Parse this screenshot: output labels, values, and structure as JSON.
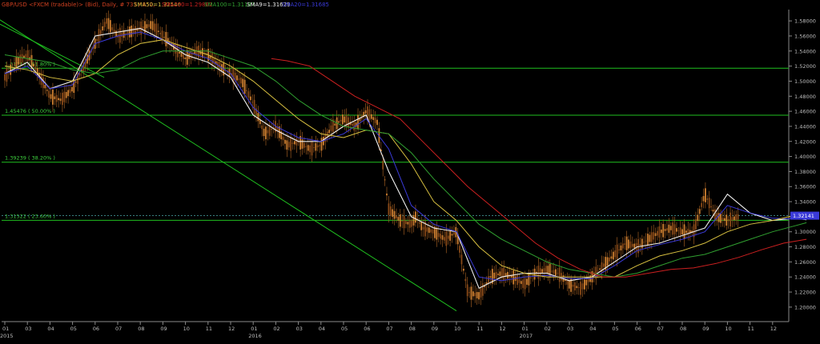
{
  "header": {
    "symbol": "GBP/USD <FXCM (tradable)> (Bid), Daily, # 733 / 852,",
    "sma50": "SMA50=1.32546",
    "sma200": "SMA200=1.29862",
    "sma100": "SMA100=1.31187",
    "sma9": "SMA9=1.31629",
    "sma20": "SMA20=1.31685",
    "colors": {
      "symbol": "#d04020",
      "sma50": "#d8c040",
      "sma200": "#cc2020",
      "sma100": "#30a030",
      "sma9": "#e8e8e8",
      "sma20": "#3a3ad8"
    }
  },
  "price_tag": {
    "value": "1.32141",
    "bg": "#3a3ad8"
  },
  "fib_levels": [
    {
      "label": "1.51713 ( 61.80% )",
      "value": 1.51713
    },
    {
      "label": "1.45476 ( 50.00% )",
      "value": 1.45476
    },
    {
      "label": "1.39239 ( 38.20% )",
      "value": 1.39239
    },
    {
      "label": "1.31522 ( 23.60% )",
      "value": 1.31522
    }
  ],
  "chart_data": {
    "type": "candlestick",
    "title": "",
    "xlabel": "",
    "ylabel": "",
    "ylim": [
      1.185,
      1.595
    ],
    "grid": false,
    "y_ticks": [
      "1.58000",
      "1.56000",
      "1.54000",
      "1.52000",
      "1.50000",
      "1.48000",
      "1.46000",
      "1.44000",
      "1.42000",
      "1.40000",
      "1.38000",
      "1.36000",
      "1.34000",
      "1.32000",
      "1.30000",
      "1.28000",
      "1.26000",
      "1.24000",
      "1.22000",
      "1.20000"
    ],
    "x_ticks": [
      "01",
      "03",
      "04",
      "05",
      "06",
      "07",
      "08",
      "09",
      "10",
      "11",
      "12",
      "01",
      "02",
      "03",
      "04",
      "05",
      "06",
      "07",
      "08",
      "09",
      "10",
      "11",
      "12",
      "01",
      "02",
      "03",
      "04",
      "05",
      "06",
      "07",
      "08",
      "09",
      "10",
      "11",
      "12"
    ],
    "x_years": [
      {
        "label": "2015",
        "at_tick": 0
      },
      {
        "label": "2016",
        "at_tick": 11
      },
      {
        "label": "2017",
        "at_tick": 23
      }
    ],
    "series": [
      {
        "name": "GBP/USD",
        "months": [
          0,
          0.5,
          1,
          1.5,
          2,
          2.5,
          3,
          3.5,
          4,
          4.5,
          5,
          5.5,
          6,
          6.5,
          7,
          7.5,
          8,
          8.5,
          9,
          9.5,
          10,
          10.5,
          11,
          11.5,
          12,
          12.5,
          13,
          13.5,
          14,
          14.5,
          15,
          15.5,
          16,
          16.5,
          17,
          17.5,
          18,
          18.2,
          18.5,
          19,
          19.5,
          20,
          20.5,
          21,
          21.5,
          22,
          22.5,
          23,
          23.5,
          24,
          24.5,
          25,
          25.5,
          26,
          26.5,
          27,
          27.5,
          28,
          28.5,
          29,
          29.5,
          30,
          30.5,
          31,
          31.5,
          32,
          32.5,
          33,
          33.5,
          34,
          34.5,
          35,
          35.5
        ],
        "values": [
          1.505,
          1.525,
          1.535,
          1.51,
          1.48,
          1.475,
          1.49,
          1.52,
          1.55,
          1.58,
          1.56,
          1.565,
          1.57,
          1.575,
          1.56,
          1.545,
          1.53,
          1.54,
          1.535,
          1.52,
          1.51,
          1.5,
          1.47,
          1.43,
          1.44,
          1.415,
          1.42,
          1.41,
          1.415,
          1.44,
          1.45,
          1.44,
          1.46,
          1.445,
          1.33,
          1.315,
          1.31,
          1.32,
          1.305,
          1.3,
          1.29,
          1.3,
          1.22,
          1.215,
          1.24,
          1.245,
          1.24,
          1.23,
          1.245,
          1.25,
          1.245,
          1.23,
          1.225,
          1.24,
          1.255,
          1.27,
          1.285,
          1.28,
          1.29,
          1.3,
          1.305,
          1.3,
          1.3,
          1.35,
          1.32,
          1.315,
          1.32
        ]
      },
      {
        "name": "SMA9",
        "months": [
          0,
          1,
          2,
          3,
          4,
          5,
          6,
          7,
          8,
          9,
          10,
          11,
          12,
          13,
          14,
          15,
          16,
          17,
          18,
          19,
          20,
          21,
          22,
          23,
          24,
          25,
          26,
          27,
          28,
          29,
          30,
          31,
          32,
          33,
          34,
          35,
          35.5
        ],
        "values": [
          1.51,
          1.525,
          1.49,
          1.5,
          1.56,
          1.565,
          1.57,
          1.555,
          1.535,
          1.525,
          1.505,
          1.455,
          1.435,
          1.42,
          1.42,
          1.44,
          1.455,
          1.38,
          1.32,
          1.305,
          1.3,
          1.225,
          1.24,
          1.245,
          1.245,
          1.235,
          1.24,
          1.26,
          1.28,
          1.285,
          1.295,
          1.305,
          1.35,
          1.325,
          1.315,
          1.318,
          1.316
        ]
      },
      {
        "name": "SMA20",
        "months": [
          0,
          1,
          2,
          3,
          4,
          5,
          6,
          7,
          8,
          9,
          10,
          11,
          12,
          13,
          14,
          15,
          16,
          17,
          18,
          19,
          20,
          21,
          22,
          23,
          24,
          25,
          26,
          27,
          28,
          29,
          30,
          31,
          32,
          33,
          34,
          35,
          35.5
        ],
        "values": [
          1.51,
          1.52,
          1.49,
          1.495,
          1.55,
          1.56,
          1.565,
          1.555,
          1.54,
          1.53,
          1.51,
          1.465,
          1.44,
          1.425,
          1.42,
          1.43,
          1.45,
          1.41,
          1.335,
          1.31,
          1.3,
          1.24,
          1.235,
          1.24,
          1.242,
          1.238,
          1.238,
          1.255,
          1.275,
          1.283,
          1.29,
          1.3,
          1.335,
          1.325,
          1.318,
          1.317,
          1.317
        ]
      },
      {
        "name": "SMA50",
        "months": [
          0,
          1,
          2,
          3,
          4,
          5,
          6,
          7,
          8,
          9,
          10,
          11,
          12,
          13,
          14,
          15,
          16,
          17,
          18,
          19,
          20,
          21,
          22,
          23,
          24,
          25,
          26,
          27,
          28,
          29,
          30,
          31,
          32,
          33,
          34,
          35,
          35.5
        ],
        "values": [
          1.52,
          1.515,
          1.505,
          1.5,
          1.51,
          1.535,
          1.55,
          1.555,
          1.545,
          1.535,
          1.52,
          1.5,
          1.475,
          1.45,
          1.43,
          1.425,
          1.435,
          1.43,
          1.39,
          1.34,
          1.315,
          1.28,
          1.255,
          1.245,
          1.24,
          1.24,
          1.24,
          1.24,
          1.255,
          1.268,
          1.275,
          1.285,
          1.3,
          1.31,
          1.315,
          1.322,
          1.325
        ]
      },
      {
        "name": "SMA100",
        "months": [
          0,
          1,
          2,
          3,
          4,
          5,
          6,
          7,
          8,
          9,
          10,
          11,
          12,
          13,
          14,
          15,
          16,
          17,
          18,
          19,
          20,
          21,
          22,
          23,
          24,
          25,
          26,
          27,
          28,
          29,
          30,
          31,
          32,
          33,
          34,
          35,
          35.5
        ],
        "values": [
          1.535,
          1.53,
          1.525,
          1.515,
          1.51,
          1.515,
          1.53,
          1.54,
          1.54,
          1.54,
          1.53,
          1.52,
          1.5,
          1.475,
          1.455,
          1.44,
          1.435,
          1.43,
          1.405,
          1.37,
          1.34,
          1.31,
          1.29,
          1.275,
          1.26,
          1.25,
          1.245,
          1.24,
          1.245,
          1.255,
          1.265,
          1.27,
          1.28,
          1.29,
          1.3,
          1.308,
          1.312
        ]
      },
      {
        "name": "SMA200",
        "months": [
          11.8,
          12.5,
          13.5,
          14.5,
          15.5,
          16.5,
          17.5,
          18.5,
          19.5,
          20.5,
          21.5,
          22.5,
          23.5,
          24.5,
          25.5,
          26.5,
          27.5,
          28.5,
          29.5,
          30.5,
          31.5,
          32.5,
          33.5,
          34.5,
          35.5
        ],
        "values": [
          1.53,
          1.527,
          1.52,
          1.5,
          1.48,
          1.465,
          1.45,
          1.42,
          1.39,
          1.36,
          1.335,
          1.31,
          1.285,
          1.265,
          1.25,
          1.24,
          1.24,
          1.245,
          1.25,
          1.252,
          1.258,
          1.266,
          1.276,
          1.285,
          1.29
        ]
      }
    ],
    "trendlines": [
      {
        "name": "trendline-upper",
        "from": [
          -0.3,
          1.583
        ],
        "to": [
          20,
          1.195
        ]
      },
      {
        "name": "trendline-lower",
        "from": [
          -0.3,
          1.577
        ],
        "to": [
          4.4,
          1.505
        ]
      }
    ]
  }
}
